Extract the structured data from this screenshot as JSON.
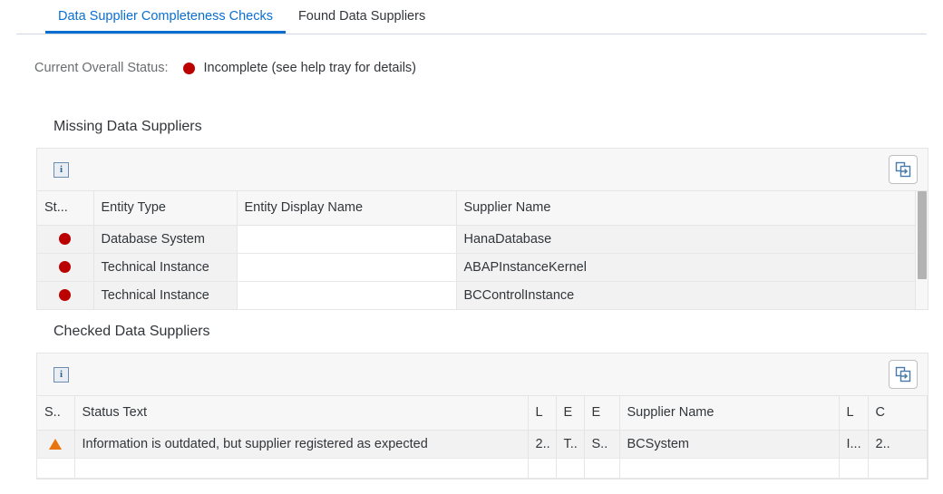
{
  "tabs": [
    {
      "label": "Data Supplier Completeness Checks",
      "selected": true
    },
    {
      "label": "Found Data Suppliers",
      "selected": false
    }
  ],
  "status": {
    "label": "Current Overall Status:",
    "value": "Incomplete (see help tray for details)",
    "indicator_color": "#bb0000",
    "indicator_icon": "status-dot-error"
  },
  "colors": {
    "accent": "#0a6ed1",
    "error": "#bb0000",
    "warning": "#e9730c",
    "header_bg": "#f7f7f7",
    "row_bg": "#f2f2f2"
  },
  "missing_section": {
    "title": "Missing Data Suppliers",
    "toolbar": {
      "info_icon": "info-icon",
      "info_label": "i",
      "export_icon": "export-icon"
    },
    "columns": [
      "St...",
      "Entity Type",
      "Entity Display Name",
      "Supplier Name"
    ],
    "rows": [
      {
        "status": "status-dot-error",
        "entity_type": "Database System",
        "entity_display_name": "",
        "supplier_name": "HanaDatabase"
      },
      {
        "status": "status-dot-error",
        "entity_type": "Technical Instance",
        "entity_display_name": "",
        "supplier_name": "ABAPInstanceKernel"
      },
      {
        "status": "status-dot-error",
        "entity_type": "Technical Instance",
        "entity_display_name": "",
        "supplier_name": "BCControlInstance"
      }
    ]
  },
  "checked_section": {
    "title": "Checked Data Suppliers",
    "toolbar": {
      "info_icon": "info-icon",
      "info_label": "i",
      "export_icon": "export-icon"
    },
    "columns": [
      "S..",
      "Status Text",
      "L",
      "E",
      "E",
      "Supplier Name",
      "L",
      "C"
    ],
    "rows": [
      {
        "status": "status-warning-triangle",
        "status_text": "Information is outdated, but supplier registered as expected",
        "col_l1": "2..",
        "col_e1": "T..",
        "col_e2": "S..",
        "supplier_name": "BCSystem",
        "col_l2": "I...",
        "col_c": "2.."
      }
    ]
  }
}
